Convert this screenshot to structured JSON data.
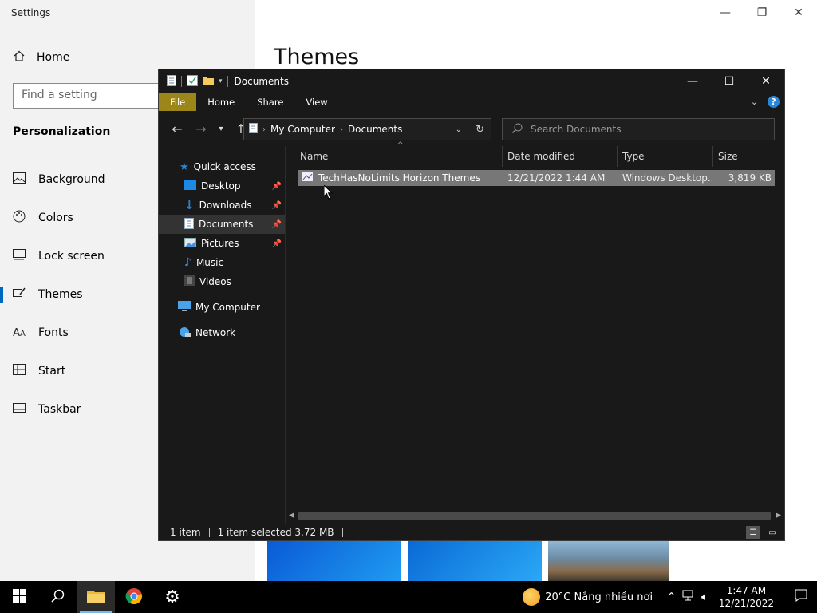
{
  "settings": {
    "title": "Settings",
    "home_label": "Home",
    "search_placeholder": "Find a setting",
    "section_title": "Personalization",
    "nav_items": [
      {
        "label": "Background",
        "icon": "image-icon"
      },
      {
        "label": "Colors",
        "icon": "palette-icon"
      },
      {
        "label": "Lock screen",
        "icon": "monitor-icon"
      },
      {
        "label": "Themes",
        "icon": "brush-icon",
        "active": true
      },
      {
        "label": "Fonts",
        "icon": "font-icon"
      },
      {
        "label": "Start",
        "icon": "grid-icon"
      },
      {
        "label": "Taskbar",
        "icon": "taskbar-icon"
      }
    ],
    "page_heading": "Themes"
  },
  "explorer": {
    "title": "Documents",
    "ribbon_tabs": [
      "File",
      "Home",
      "Share",
      "View"
    ],
    "address": {
      "root": "My Computer",
      "current": "Documents"
    },
    "search_placeholder": "Search Documents",
    "nav_pane": {
      "quick_access": "Quick access",
      "items": [
        {
          "label": "Desktop",
          "pinned": true
        },
        {
          "label": "Downloads",
          "pinned": true
        },
        {
          "label": "Documents",
          "pinned": true,
          "selected": true
        },
        {
          "label": "Pictures",
          "pinned": true
        },
        {
          "label": "Music",
          "pinned": false
        },
        {
          "label": "Videos",
          "pinned": false
        }
      ],
      "my_computer": "My Computer",
      "network": "Network"
    },
    "columns": [
      "Name",
      "Date modified",
      "Type",
      "Size"
    ],
    "files": [
      {
        "name": "TechHasNoLimits Horizon Themes",
        "date": "12/21/2022 1:44 AM",
        "type": "Windows Desktop...",
        "size": "3,819 KB"
      }
    ],
    "status": {
      "count": "1 item",
      "selected": "1 item selected  3.72 MB"
    }
  },
  "taskbar": {
    "weather": "20°C  Nắng nhiều nơi",
    "time": "1:47 AM",
    "date": "12/21/2022"
  }
}
